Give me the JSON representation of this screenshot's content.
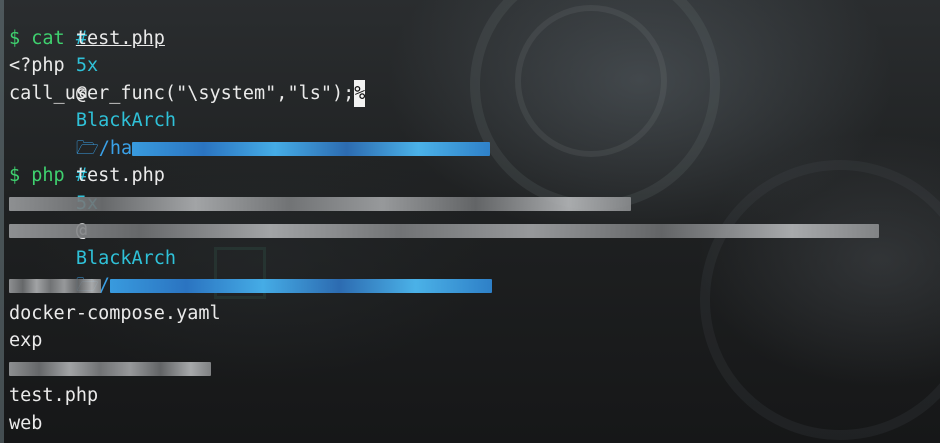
{
  "terminal": {
    "prompt1": {
      "hash": "#",
      "user": "5x",
      "at": "@",
      "host": "BlackArch",
      "folder_icon": "folder-icon",
      "path_prefix": "/ha"
    },
    "command1": {
      "symbol": "$",
      "cmd": "cat",
      "arg": "test.php"
    },
    "file_lines": [
      "<?php",
      "call_user_func(\"\\system\",\"ls\");"
    ],
    "cursor_char": "%",
    "prompt2": {
      "hash": "#",
      "user": "5x",
      "at": "@",
      "host": "BlackArch",
      "folder_icon": "folder-icon",
      "path_prefix": "/"
    },
    "command2": {
      "symbol": "$",
      "cmd": "php",
      "arg": "test.php"
    },
    "output_visible": [
      "docker-compose.yaml",
      "exp",
      "test.php",
      "web"
    ]
  },
  "colors": {
    "prompt_cyan": "#2fc1d8",
    "command_green": "#3fd16f",
    "path_blue": "#3aa1e8",
    "text": "#eaeaea"
  }
}
